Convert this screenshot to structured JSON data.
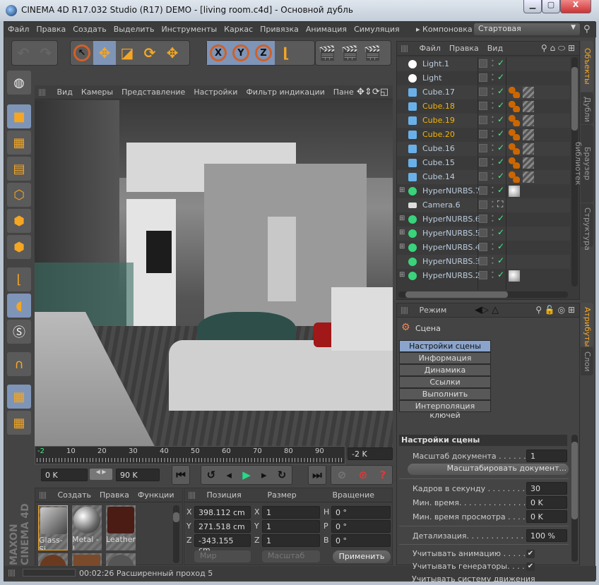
{
  "window": {
    "title": "CINEMA 4D R17.032 Studio (R17) DEMO - [living room.c4d] - Основной дубль",
    "minimize": "▁",
    "maximize": "▢",
    "close": "X"
  },
  "menu": {
    "items": [
      "Файл",
      "Правка",
      "Создать",
      "Выделить",
      "Инструменты",
      "Каркас",
      "Привязка",
      "Анимация",
      "Симуляция"
    ],
    "layout_label": "Компоновка",
    "layout_value": "Стартовая"
  },
  "viewport": {
    "menu": [
      "Вид",
      "Камеры",
      "Представление",
      "Настройки",
      "Фильтр индикации",
      "Пане"
    ]
  },
  "timeline": {
    "ticks": [
      "-2",
      "10",
      "20",
      "30",
      "40",
      "50",
      "60",
      "70",
      "80",
      "90"
    ],
    "current": "-2 K",
    "start": "0 K",
    "end": "90 K"
  },
  "materials": {
    "menu": [
      "Создать",
      "Правка",
      "Функции"
    ],
    "items": [
      {
        "name": "Glass-Si"
      },
      {
        "name": "Metal - !"
      },
      {
        "name": "Leather-"
      }
    ]
  },
  "coords": {
    "headers": [
      "Позиция",
      "Размер",
      "Вращение"
    ],
    "position": [
      {
        "axis": "X",
        "value": "398.112 cm"
      },
      {
        "axis": "Y",
        "value": "271.518 cm"
      },
      {
        "axis": "Z",
        "value": "-343.155 cm"
      }
    ],
    "size": [
      {
        "axis": "X",
        "value": "1"
      },
      {
        "axis": "Y",
        "value": "1"
      },
      {
        "axis": "Z",
        "value": "1"
      }
    ],
    "rotation": [
      {
        "axis": "H",
        "value": "0 °"
      },
      {
        "axis": "P",
        "value": "0 °"
      },
      {
        "axis": "B",
        "value": "0 °"
      }
    ],
    "mode1": "Мир",
    "mode2": "Масштаб",
    "apply": "Применить"
  },
  "status": {
    "text": "00:02:26 Расширенный проход 5"
  },
  "brand": "MAXON CINEMA 4D",
  "objects": {
    "menu": [
      "Файл",
      "Правка",
      "Вид"
    ],
    "rows": [
      {
        "name": "Light.1",
        "type": "light",
        "selected": false,
        "tags": []
      },
      {
        "name": "Light",
        "type": "light",
        "selected": false,
        "tags": []
      },
      {
        "name": "Cube.17",
        "type": "cube",
        "selected": false,
        "tags": [
          "phong",
          "material"
        ]
      },
      {
        "name": "Cube.18",
        "type": "cube",
        "selected": true,
        "tags": [
          "phong",
          "material"
        ]
      },
      {
        "name": "Cube.19",
        "type": "cube",
        "selected": true,
        "tags": [
          "phong",
          "material"
        ]
      },
      {
        "name": "Cube.20",
        "type": "cube",
        "selected": true,
        "tags": [
          "phong",
          "material"
        ]
      },
      {
        "name": "Cube.16",
        "type": "cube",
        "selected": false,
        "tags": [
          "phong",
          "material"
        ]
      },
      {
        "name": "Cube.15",
        "type": "cube",
        "selected": false,
        "tags": [
          "phong",
          "material"
        ]
      },
      {
        "name": "Cube.14",
        "type": "cube",
        "selected": false,
        "tags": [
          "phong",
          "material"
        ]
      },
      {
        "name": "HyperNURBS.7",
        "type": "nurbs",
        "selected": false,
        "tags": [
          "sphere-material"
        ]
      },
      {
        "name": "Camera.6",
        "type": "camera",
        "selected": false,
        "tags": []
      },
      {
        "name": "HyperNURBS.6",
        "type": "nurbs",
        "selected": false,
        "tags": []
      },
      {
        "name": "HyperNURBS.5",
        "type": "nurbs",
        "selected": false,
        "tags": []
      },
      {
        "name": "HyperNURBS.4",
        "type": "nurbs",
        "selected": false,
        "tags": []
      },
      {
        "name": "HyperNURBS.3",
        "type": "nurbs",
        "selected": false,
        "tags": []
      },
      {
        "name": "HyperNURBS.2",
        "type": "nurbs",
        "selected": false,
        "tags": [
          "sphere-material"
        ]
      }
    ]
  },
  "side_tabs_top": [
    "Объекты",
    "Дубли",
    "Браузер библиотек",
    "Структура"
  ],
  "side_tabs_bottom": [
    "Атрибуты",
    "Слои"
  ],
  "attributes": {
    "mode": "Режим",
    "object": "Сцена",
    "tabs": [
      "Настройки сцены",
      "Информация",
      "Динамика",
      "Ссылки",
      "Выполнить",
      "Интерполяция ключей"
    ],
    "section": "Настройки сцены",
    "doc_scale_label": "Масштаб документа . . . . . . . .",
    "doc_scale": "1",
    "scale_button": "Масштабировать документ...",
    "fps_label": "Кадров в секунду . . . . . . . . . . .",
    "fps": "30",
    "min_time_label": "Мин. время. . . . . . . . . . . . . . .",
    "min_time": "0 K",
    "min_preview_label": "Мин. время просмотра . . . . .",
    "min_preview": "0 K",
    "lod_label": "Детализация. . . . . . . . . . . . . . .",
    "lod": "100 %",
    "checks": [
      {
        "label": "Учитывать анимацию . . . . . . .",
        "checked": true
      },
      {
        "label": "Учитывать генераторы. . . . . .",
        "checked": true
      },
      {
        "label": "Учитывать систему движения",
        "checked": true
      }
    ]
  },
  "colors": {
    "accent": "#f5a623",
    "selected_tab": "#8aa4cc",
    "selected_object": "#f5b400"
  }
}
